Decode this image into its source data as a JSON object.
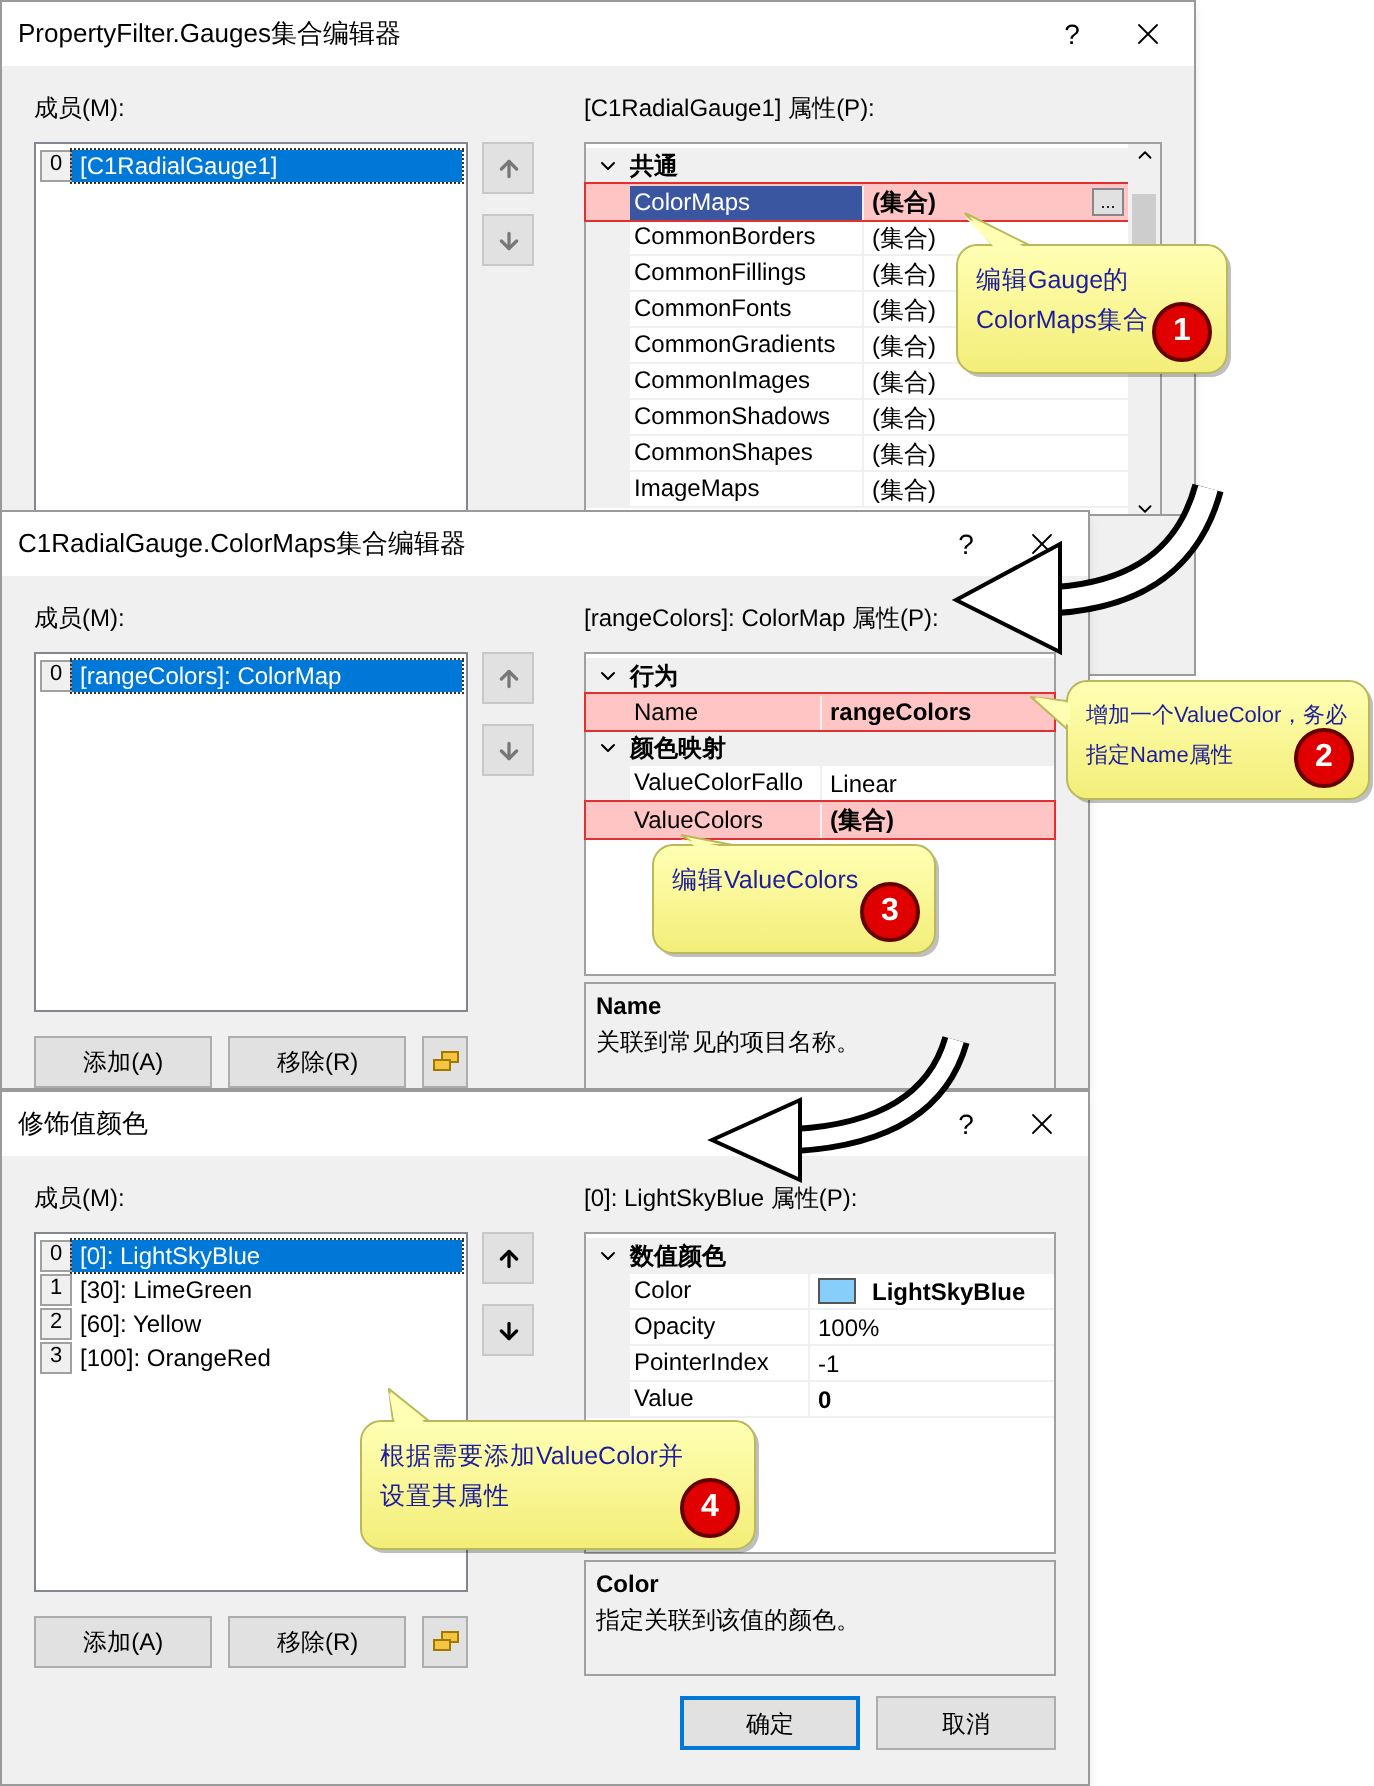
{
  "dialogs": [
    {
      "title": "PropertyFilter.Gauges集合编辑器",
      "help": "?",
      "members_label": "成员(M):",
      "members": [
        {
          "index": "0",
          "text": "[C1RadialGauge1]",
          "selected": true
        }
      ],
      "properties_label": "[C1RadialGauge1] 属性(P):",
      "categories": [
        {
          "name": "共通",
          "expanded": true,
          "rows": [
            {
              "name": "ColorMaps",
              "value": "(集合)",
              "selected": true,
              "bold": true,
              "highlighted": true,
              "button": "..."
            },
            {
              "name": "CommonBorders",
              "value": "(集合)",
              "selected": false,
              "bold": false,
              "highlighted": false
            },
            {
              "name": "CommonFillings",
              "value": "(集合)",
              "selected": false,
              "bold": false,
              "highlighted": false
            },
            {
              "name": "CommonFonts",
              "value": "(集合)",
              "selected": false,
              "bold": false,
              "highlighted": false
            },
            {
              "name": "CommonGradients",
              "value": "(集合)",
              "selected": false,
              "bold": false,
              "highlighted": false
            },
            {
              "name": "CommonImages",
              "value": "(集合)",
              "selected": false,
              "bold": false,
              "highlighted": false
            },
            {
              "name": "CommonShadows",
              "value": "(集合)",
              "selected": false,
              "bold": false,
              "highlighted": false
            },
            {
              "name": "CommonShapes",
              "value": "(集合)",
              "selected": false,
              "bold": false,
              "highlighted": false
            },
            {
              "name": "ImageMaps",
              "value": "(集合)",
              "selected": false,
              "bold": false,
              "highlighted": false
            }
          ]
        }
      ]
    },
    {
      "title": "C1RadialGauge.ColorMaps集合编辑器",
      "help": "?",
      "members_label": "成员(M):",
      "members": [
        {
          "index": "0",
          "text": "[rangeColors]: ColorMap",
          "selected": true
        }
      ],
      "properties_label": "[rangeColors]: ColorMap 属性(P):",
      "categories": [
        {
          "name": "行为",
          "expanded": true,
          "rows": [
            {
              "name": "Name",
              "value": "rangeColors",
              "selected": false,
              "bold": true,
              "highlighted": true
            }
          ]
        },
        {
          "name": "颜色映射",
          "expanded": true,
          "rows": [
            {
              "name": "ValueColorFallo",
              "value": "Linear",
              "selected": false,
              "bold": false,
              "highlighted": false
            },
            {
              "name": "ValueColors",
              "value": "(集合)",
              "selected": false,
              "bold": true,
              "highlighted": true
            }
          ]
        }
      ],
      "description": {
        "title": "Name",
        "text": "关联到常见的项目名称。"
      },
      "buttons": [
        "添加(A)",
        "移除(R)"
      ]
    },
    {
      "title": "修饰值颜色",
      "help": "?",
      "members_label": "成员(M):",
      "members": [
        {
          "index": "0",
          "text": "[0]: LightSkyBlue",
          "selected": true
        },
        {
          "index": "1",
          "text": "[30]: LimeGreen",
          "selected": false
        },
        {
          "index": "2",
          "text": "[60]: Yellow",
          "selected": false
        },
        {
          "index": "3",
          "text": "[100]: OrangeRed",
          "selected": false
        }
      ],
      "properties_label": "[0]: LightSkyBlue 属性(P):",
      "categories": [
        {
          "name": "数值颜色",
          "expanded": true,
          "rows": [
            {
              "name": "Color",
              "value": "LightSkyBlue",
              "selected": false,
              "bold": true,
              "highlighted": false,
              "color": "#87cefa"
            },
            {
              "name": "Opacity",
              "value": "100%",
              "selected": false,
              "bold": false,
              "highlighted": false
            },
            {
              "name": "PointerIndex",
              "value": "-1",
              "selected": false,
              "bold": false,
              "highlighted": false
            },
            {
              "name": "Value",
              "value": "0",
              "selected": false,
              "bold": true,
              "highlighted": false
            }
          ]
        }
      ],
      "description": {
        "title": "Color",
        "text": "指定关联到该值的颜色。"
      },
      "buttons": [
        "添加(A)",
        "移除(R)"
      ],
      "ok": "确定",
      "cancel": "取消"
    }
  ],
  "callouts": [
    {
      "lines": [
        "编辑Gauge的",
        "ColorMaps集合"
      ],
      "number": "1"
    },
    {
      "lines": [
        "增加一个ValueColor，务必",
        "指定Name属性"
      ],
      "number": "2"
    },
    {
      "lines": [
        "编辑ValueColors"
      ],
      "number": "3"
    },
    {
      "lines": [
        "根据需要添加ValueColor并",
        "设置其属性"
      ],
      "number": "4"
    }
  ]
}
